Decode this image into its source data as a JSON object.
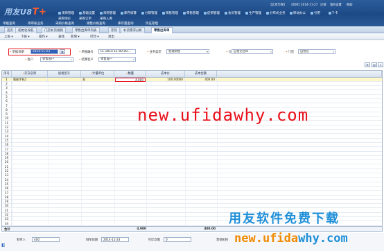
{
  "header": {
    "logo_text": "用友U8",
    "logo_suffix": "T+",
    "system_bar": [
      "【北京华界】",
      "【400】",
      "2014-11-27",
      "注销",
      "我的设置",
      "帮助"
    ],
    "nav_row1": [
      "采购管理",
      "基础设置",
      "采购管理",
      "库存核算",
      "分销管理",
      "销售管理",
      "零售管理",
      "促销管理",
      "会员管理",
      "生产管理",
      "分布式业务",
      "移动办公",
      "引用",
      "T-卡"
    ],
    "nav_row2": [
      "采购询价",
      "采购订单",
      "采购入库",
      "采购到货",
      "采购核算",
      "库存管理",
      "存货核算"
    ],
    "quick_row": [
      "单据查询",
      "待审核业务",
      "采购价格查询",
      "销售价格查询",
      "库存量查询",
      "凭证管理"
    ]
  },
  "open_tabs": [
    "首页",
    "初始化导航",
    "门店补货规则",
    "零售出库单列表",
    "存货",
    "补货需求分析",
    "零售出库单"
  ],
  "active_tab_index": 6,
  "toolbar": [
    "上张",
    "下张",
    "操作",
    "查找",
    "新增",
    "打印",
    "退出"
  ],
  "form": {
    "date_label": "单据日期",
    "date_value": "2014-11-23",
    "doc_no_label": "单据编号",
    "doc_no_value": "LC-2014-11-00-00...",
    "biz_type_label": "业务类型",
    "biz_type_value": "普通销售",
    "warehouse_label": "仓库",
    "warehouse_value": "自营店仓库",
    "store_label": "门店",
    "store_value": "自营店",
    "customer_label": "客户",
    "customer_value": "零售客户",
    "settle_label": "结算客户",
    "settle_value": "零售客户"
  },
  "grid": {
    "headers": [
      "序号",
      "存货名称",
      "规格型号",
      "计量单位",
      "数量",
      "成本价",
      "成本金额"
    ],
    "rows": [
      {
        "no": "1",
        "name": "智能手机1",
        "spec": "",
        "unit": "台",
        "qty": "4.000",
        "cost": "100.00000",
        "amount": "400.00"
      }
    ],
    "row_numbers": [
      "2",
      "3",
      "4",
      "5",
      "6",
      "7",
      "8",
      "9",
      "10",
      "11",
      "12",
      "13",
      "14",
      "15",
      "16",
      "17",
      "18",
      "19",
      "20",
      "21",
      "22",
      "23",
      "24",
      "25",
      "26",
      "27",
      "28",
      "29",
      "30",
      "31",
      "32",
      "33",
      "34"
    ]
  },
  "totals": {
    "label": "合计",
    "qty": "4.000",
    "amount": "400.00"
  },
  "footer": {
    "maker_label": "制单人",
    "maker_value": "400",
    "make_date_label": "制单日期",
    "make_date_value": "2014-11-23",
    "print_count_label": "打印次数",
    "print_count_value": "0",
    "org_label": "营销机构"
  },
  "watermark": {
    "url": "new.ufidawhy.com",
    "slogan": "用友软件免费下载",
    "url2_a": "new.ufida",
    "url2_b": "why.com"
  }
}
